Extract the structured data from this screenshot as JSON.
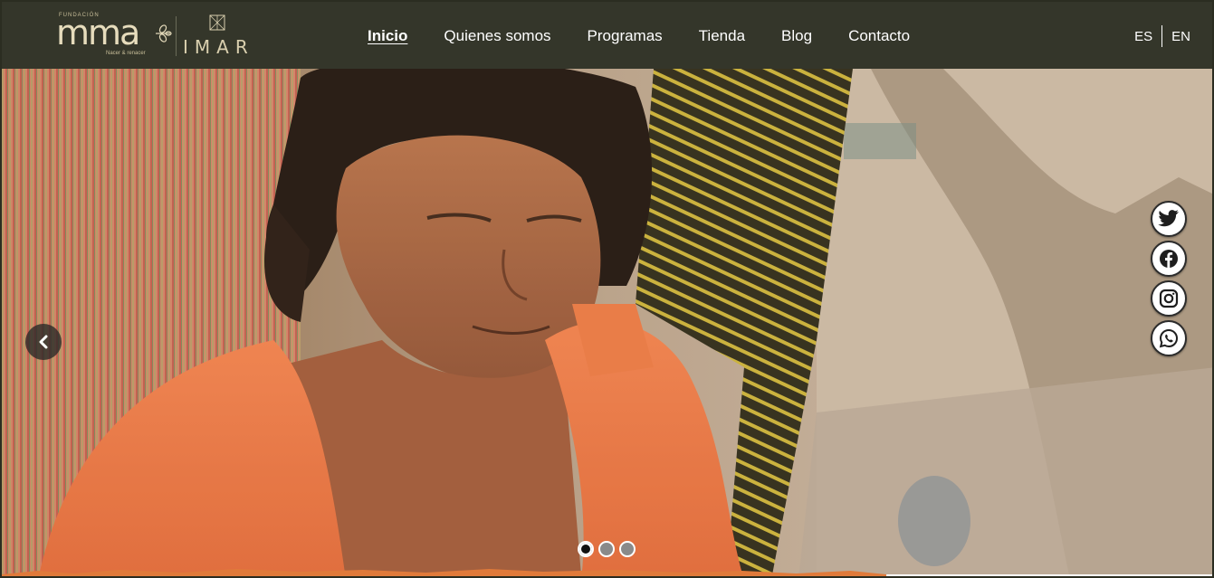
{
  "logo": {
    "fundacion": "FUNDACIÓN",
    "name": "mma",
    "tagline": "Nacer & renacer",
    "partner": "IMAR"
  },
  "nav": {
    "items": [
      {
        "label": "Inicio",
        "active": true
      },
      {
        "label": "Quienes somos",
        "active": false
      },
      {
        "label": "Programas",
        "active": false
      },
      {
        "label": "Tienda",
        "active": false
      },
      {
        "label": "Blog",
        "active": false
      },
      {
        "label": "Contacto",
        "active": false
      }
    ]
  },
  "language": {
    "es": "ES",
    "en": "EN",
    "selected": "ES"
  },
  "carousel": {
    "slide_count": 3,
    "active_index": 0
  },
  "social": [
    {
      "name": "twitter-icon"
    },
    {
      "name": "facebook-icon"
    },
    {
      "name": "instagram-icon"
    },
    {
      "name": "whatsapp-icon"
    }
  ],
  "colors": {
    "header_bg": "#34362a",
    "accent_orange": "#e07a3a",
    "logo_gold": "#e6dcbc"
  }
}
